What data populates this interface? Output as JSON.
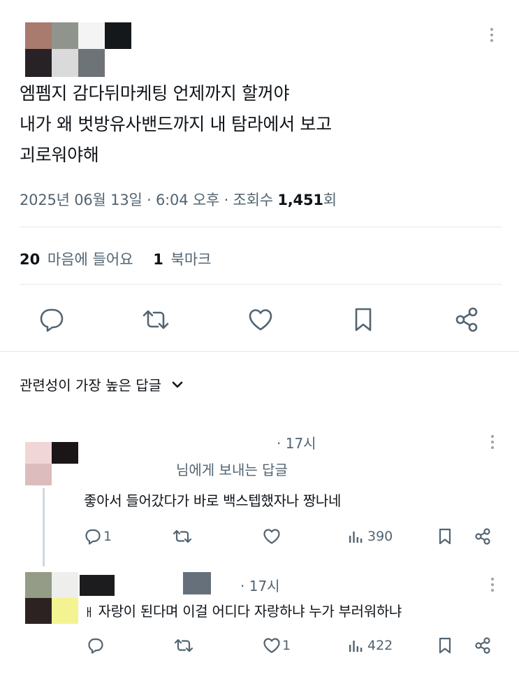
{
  "colors": {
    "text": "#0f1419",
    "muted": "#536471",
    "divider": "#e4e8eb",
    "icon": "#536471"
  },
  "main_post": {
    "avatar_pixels": [
      "#a97a6e",
      "#8f958d",
      "#f4f4f4",
      "#15181b",
      "#262225",
      "#d9dad9",
      "#6e7378",
      "#ffffff"
    ],
    "text_lines": [
      "엠펨지 감다뒤마케팅 언제까지 할꺼야",
      "내가 왜 벗방유사밴드까지 내 탐라에서 보고",
      "괴로워야해"
    ],
    "date": "2025년 06월 13일 · 6:04 오후 · 조회수 ",
    "views": "1,451",
    "views_suffix": "회",
    "likes_count": "20",
    "likes_label": "마음에 들어요",
    "bookmarks_count": "1",
    "bookmarks_label": "북마크",
    "actions": [
      "reply-icon",
      "retweet-icon",
      "like-icon",
      "bookmark-icon",
      "share-icon"
    ]
  },
  "sort": {
    "label": "관련성이 가장 높은 답글",
    "icon": "chevron-down-icon"
  },
  "replies": [
    {
      "avatar_pixels": [
        "#f0d6d6",
        "#1a1516",
        "#dcbcbc",
        "#ffffff"
      ],
      "time": "· 17시",
      "replying_to": "님에게 보내는 답글",
      "text": "좋아서 들어갔다가 바로 백스텝했자나 짱나네",
      "reply_count": "1",
      "retweet_count": "",
      "like_count": "",
      "view_count": "390"
    },
    {
      "avatar_pixels": [
        "#949b86",
        "#eeeeec",
        "#2c2222",
        "#f4f392"
      ],
      "time": "· 17시",
      "text_prefix": "ㅐ",
      "text": "자랑이 된다며 이걸 어디다 자랑하냐 누가 부러워하냐",
      "reply_count": "",
      "retweet_count": "",
      "like_count": "1",
      "view_count": "422"
    }
  ]
}
